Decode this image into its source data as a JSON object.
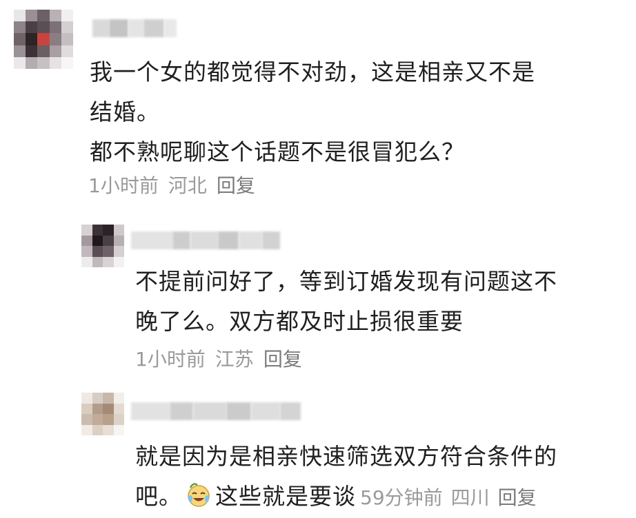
{
  "comments": [
    {
      "text_lines": [
        "我一个女的都觉得不对劲，这是相亲又不是",
        "结婚。",
        "都不熟呢聊这个话题不是很冒犯么？"
      ],
      "time": "1小时前",
      "location": "河北",
      "reply_label": "回复"
    },
    {
      "text_lines": [
        "不提前问好了，等到订婚发现有问题这不",
        "晚了么。双方都及时止损很重要"
      ],
      "time": "1小时前",
      "location": "江苏",
      "reply_label": "回复"
    },
    {
      "text_line_1": "就是因为是相亲快速筛选双方符合条件的",
      "text_line_2_before": "吧。",
      "text_line_2_after": "这些就是要谈",
      "emoji": "crying-laughing-emoji",
      "time": "59分钟前",
      "location": "四川",
      "reply_label": "回复"
    }
  ]
}
